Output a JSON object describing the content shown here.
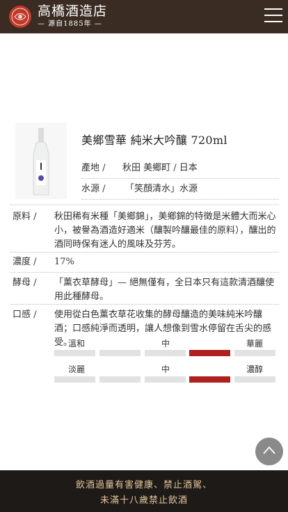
{
  "header": {
    "brand_name": "高橋酒造店",
    "brand_since": "— 源自1885年 —",
    "logo_icon": "brand-logo-icon",
    "menu_icon": "hamburger-menu-icon"
  },
  "product": {
    "title": "美鄉雪華 純米大吟釀 720ml",
    "origin_label": "產地 /",
    "origin_value": "秋田 美鄉町 / 日本",
    "water_label": "水源 /",
    "water_value": "「笑顏清水」水源"
  },
  "specs": [
    {
      "label": "原料 /",
      "value": "秋田稀有米種「美鄉錦」，美鄉錦的特徵是米體大而米心小，被譽為酒造好適米（釀製吟釀最佳的原料），釀出的酒同時保有迷人的風味及芬芳。"
    },
    {
      "label": "濃度 /",
      "value": "17%"
    },
    {
      "label": "酵母 /",
      "value": "「薰衣草酵母」— 絕無僅有，全日本只有這款清酒釀使用此種酵母。"
    },
    {
      "label": "口感 /",
      "value": "使用從白色薰衣草花收集的酵母釀造的美味純米吟釀酒；口感純淨而透明，讓人想像到雪水停留在舌尖的感受。"
    }
  ],
  "taste_scales": [
    {
      "left": "溫和",
      "middle": "中",
      "right": "華麗",
      "segments": 5,
      "active_index": 3
    },
    {
      "left": "淡麗",
      "middle": "中",
      "right": "濃醇",
      "segments": 5,
      "active_index": 3
    }
  ],
  "colors": {
    "header_bg": "#3a2c22",
    "accent_red": "#b0201f",
    "footer_bg": "#1e1a18",
    "footer_text": "#e3c69a"
  },
  "footer": {
    "line1": "飲酒過量有害健康、禁止酒駕、",
    "line2": "未滿十八歲禁止飲酒"
  },
  "back_to_top_icon": "chevron-up-icon"
}
